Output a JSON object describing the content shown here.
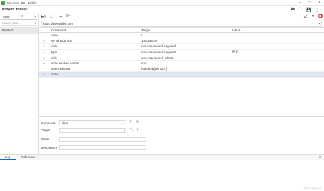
{
  "window": {
    "title": "Selenium IDE - Bilibili*"
  },
  "project": {
    "label": "Project:",
    "name": "Bilibili*"
  },
  "sidebar": {
    "selector_label": "Tests",
    "search_placeholder": "Search tests...",
    "tests": [
      "Untitled*"
    ]
  },
  "url": {
    "value": "https://www.bilibili.com"
  },
  "table": {
    "headers": {
      "command": "Command",
      "target": "Target",
      "value": "Value"
    },
    "rows": [
      {
        "num": "1",
        "command": "open",
        "target": "/",
        "value": ""
      },
      {
        "num": "2",
        "command": "set window size",
        "target": "1920x1019",
        "value": ""
      },
      {
        "num": "3",
        "command": "click",
        "target": "css=.nav-search-keyword",
        "value": ""
      },
      {
        "num": "4",
        "command": "type",
        "target": "css=.nav-search-keyword",
        "value": "胖达"
      },
      {
        "num": "5",
        "command": "click",
        "target": "css=.nav-search-submit",
        "value": ""
      },
      {
        "num": "6",
        "command": "store window handle",
        "target": "root",
        "value": ""
      },
      {
        "num": "7",
        "command": "select window",
        "target": "handle=${win7307}",
        "value": ""
      },
      {
        "num": "8",
        "command": "close",
        "target": "",
        "value": ""
      }
    ],
    "selected_index": 7
  },
  "editor": {
    "command_label": "Comment",
    "command_value": "close",
    "target_label": "Target",
    "target_value": "",
    "value_label": "Value",
    "value_value": "",
    "description_label": "Description",
    "description_value": ""
  },
  "log": {
    "tabs": [
      "Log",
      "Reference"
    ],
    "active_tab": "Log"
  },
  "watermark": "CSDN @Ubuntu",
  "colors": {
    "record": "#e53935",
    "selected_row": "#dfe6f2",
    "accent": "#1565c0"
  }
}
